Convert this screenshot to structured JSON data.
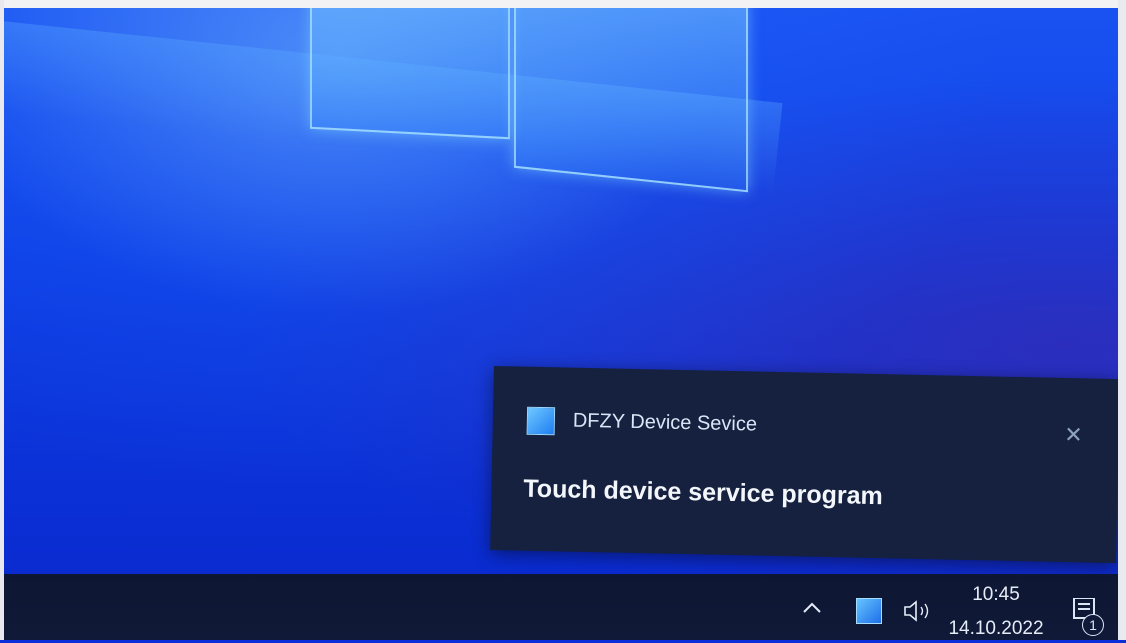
{
  "toast": {
    "app_name": "DFZY Device Sevice",
    "message": "Touch device service program",
    "close_glyph": "✕",
    "app_icon": "app-square-icon"
  },
  "taskbar": {
    "tray": {
      "chevron_icon": "chevron-up-icon",
      "app_icon": "app-square-icon",
      "volume_icon": "speaker-icon"
    },
    "clock": {
      "time": "10:45",
      "date": "14.10.2022"
    },
    "action_center": {
      "icon": "notification-icon",
      "count": "1"
    }
  },
  "colors": {
    "desktop_blue": "#0d3fe6",
    "toast_bg": "#15213e",
    "taskbar_bg": "#0d1733"
  }
}
